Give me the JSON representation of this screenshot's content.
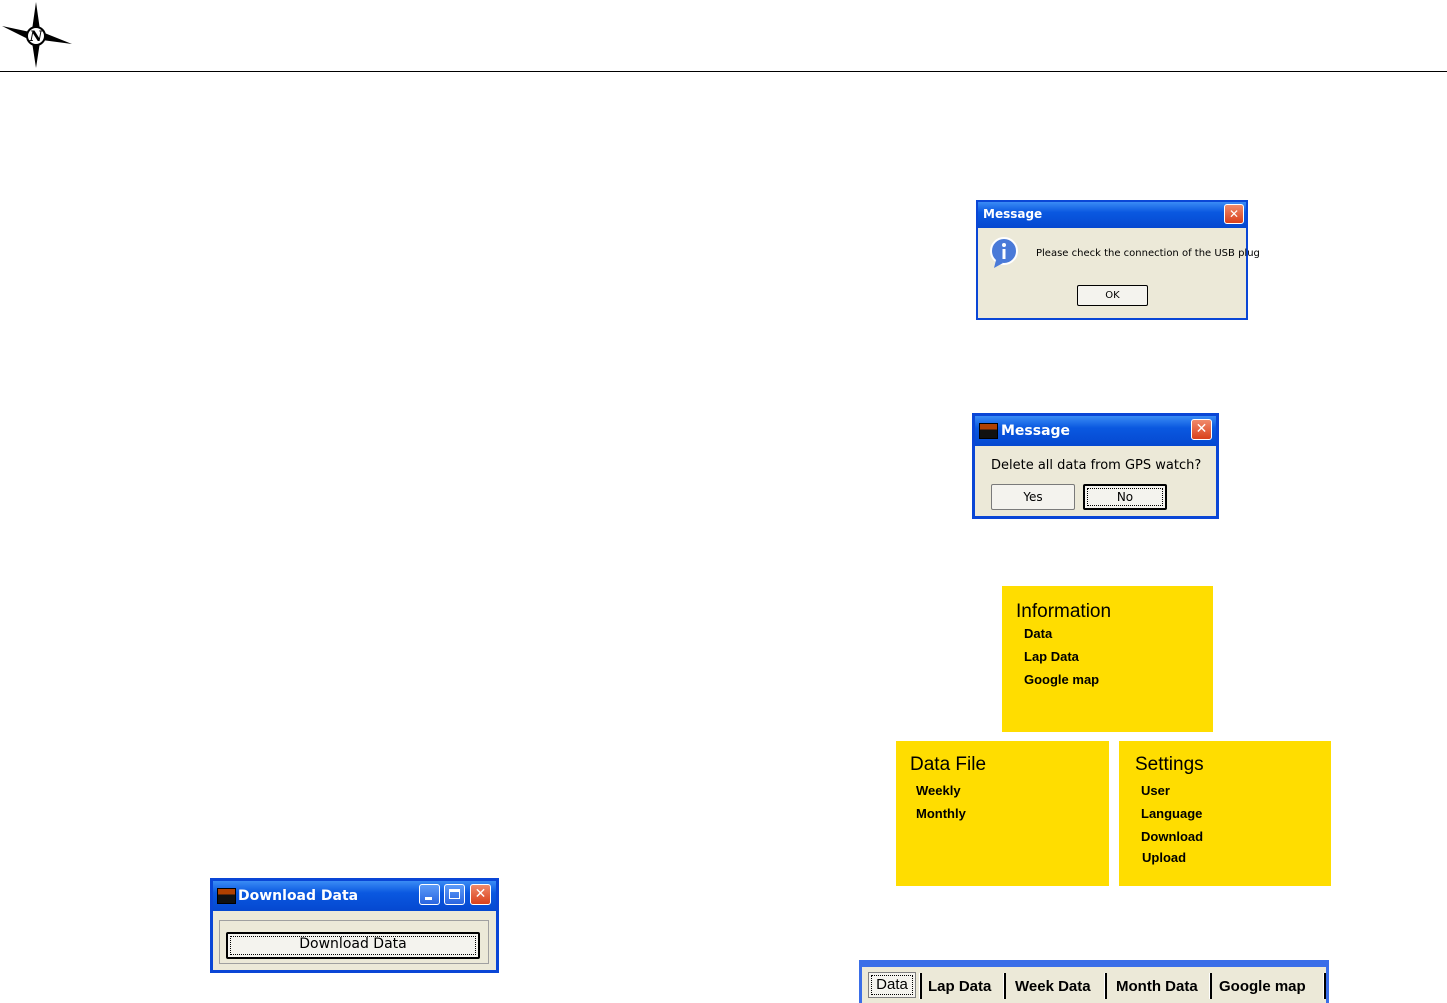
{
  "usb_message": {
    "title": "Message",
    "text": "Please check the connection of the USB plug",
    "ok_label": "OK",
    "close_glyph": "✕",
    "icon": "info-icon"
  },
  "delete_message": {
    "title": "Message",
    "text": "Delete all data from GPS watch?",
    "yes_label": "Yes",
    "no_label": "No",
    "close_glyph": "✕",
    "icon": "app-icon"
  },
  "menu": {
    "information": {
      "title": "Information",
      "items": [
        "Data",
        "Lap Data",
        "Google map"
      ]
    },
    "data_file": {
      "title": "Data File",
      "items": [
        "Weekly",
        "Monthly"
      ]
    },
    "settings": {
      "title": "Settings",
      "items": [
        "User",
        "Language",
        "Download",
        "Upload"
      ]
    }
  },
  "download_window": {
    "title": "Download Data",
    "button_label": "Download Data",
    "close_glyph": "✕",
    "icon": "app-icon"
  },
  "tabs": [
    "Data",
    "Lap Data",
    "Week Data",
    "Month Data",
    "Google map"
  ],
  "colors": {
    "xp_blue": "#0a46d6",
    "dialog_bg": "#ece9d8",
    "menu_yellow": "#ffdd00",
    "close_red": "#d9401c"
  }
}
